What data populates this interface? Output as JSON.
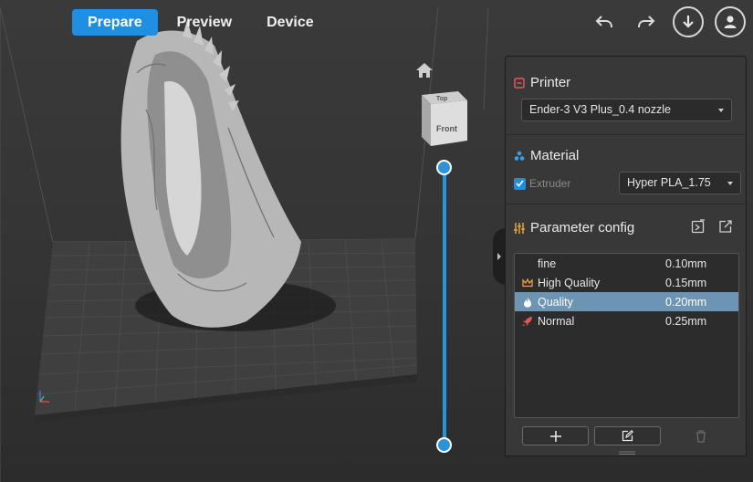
{
  "tabs": [
    {
      "label": "Prepare",
      "active": true
    },
    {
      "label": "Preview",
      "active": false
    },
    {
      "label": "Device",
      "active": false
    }
  ],
  "toolbar": {
    "undo_icon": "undo-icon",
    "redo_icon": "redo-icon",
    "download_icon": "download-icon",
    "account_icon": "user-icon"
  },
  "viewcube": {
    "top_label": "Top",
    "front_label": "Front"
  },
  "printer": {
    "title": "Printer",
    "selected": "Ender-3 V3 Plus_0.4 nozzle"
  },
  "material": {
    "title": "Material",
    "extruder_label": "Extruder",
    "extruder_checked": true,
    "selected": "Hyper PLA_1.75"
  },
  "parameter_config": {
    "title": "Parameter config",
    "profiles": [
      {
        "name": "fine",
        "value": "0.10mm",
        "icon": "none",
        "selected": false
      },
      {
        "name": "High Quality",
        "value": "0.15mm",
        "icon": "crown-icon",
        "selected": false
      },
      {
        "name": "Quality",
        "value": "0.20mm",
        "icon": "flame-icon",
        "selected": true
      },
      {
        "name": "Normal",
        "value": "0.25mm",
        "icon": "rocket-icon",
        "selected": false
      }
    ]
  },
  "colors": {
    "accent": "#1f8fe3",
    "slider": "#2a94d9",
    "selected_row": "#6e94b3",
    "printer_icon": "#e0585a",
    "material_icon": "#3a9ee6",
    "param_icon": "#e8a33a"
  }
}
